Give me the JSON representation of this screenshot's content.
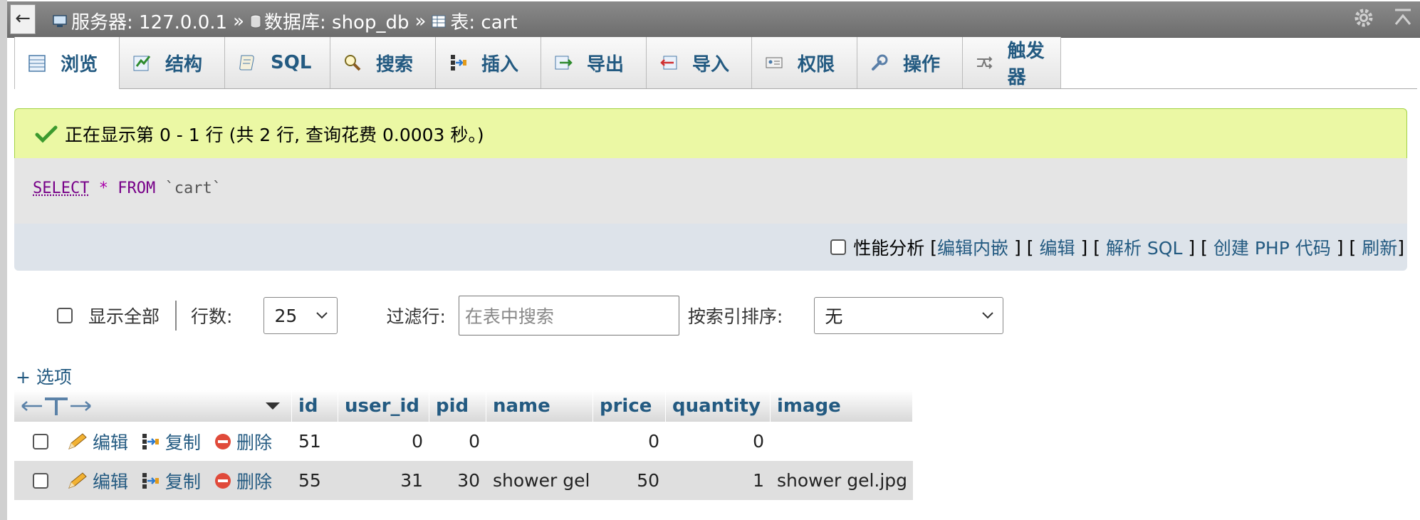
{
  "breadcrumb": {
    "server": "服务器: 127.0.0.1",
    "database": "数据库: shop_db",
    "table": "表: cart",
    "separator": "»"
  },
  "nav_back": "←",
  "tabs": [
    {
      "label": "浏览",
      "icon": "browse-icon"
    },
    {
      "label": "结构",
      "icon": "structure-icon"
    },
    {
      "label": "SQL",
      "icon": "sql-icon"
    },
    {
      "label": "搜索",
      "icon": "search-icon"
    },
    {
      "label": "插入",
      "icon": "insert-icon"
    },
    {
      "label": "导出",
      "icon": "export-icon"
    },
    {
      "label": "导入",
      "icon": "import-icon"
    },
    {
      "label": "权限",
      "icon": "privileges-icon"
    },
    {
      "label": "操作",
      "icon": "wrench-icon"
    },
    {
      "label": "触发器",
      "icon": "triggers-icon"
    }
  ],
  "message": "正在显示第 0 - 1 行 (共 2 行, 查询花费 0.0003 秒。)",
  "sql": {
    "select": "SELECT",
    "star": "*",
    "from": "FROM",
    "table": "`cart`"
  },
  "sql_links": {
    "profiling": "性能分析",
    "open": "[",
    "inline_edit": "编辑内嵌",
    "mid1": "] [",
    "edit": "编辑",
    "mid2": "] [",
    "explain": "解析 SQL",
    "mid3": "] [",
    "php": "创建 PHP 代码",
    "mid4": "] [",
    "refresh": "刷新",
    "close": "]"
  },
  "navigation": {
    "show_all": "显示全部",
    "rows_label": "行数:",
    "rows_value": "25",
    "filter_label": "过滤行:",
    "filter_placeholder": "在表中搜索",
    "sort_label": "按索引排序:",
    "sort_value": "无"
  },
  "options_link": "+ 选项",
  "table": {
    "columns": [
      "id",
      "user_id",
      "pid",
      "name",
      "price",
      "quantity",
      "image"
    ],
    "action_labels": {
      "edit": "编辑",
      "copy": "复制",
      "delete": "删除"
    },
    "rows": [
      {
        "id": "51",
        "user_id": "0",
        "pid": "0",
        "name": "",
        "price": "0",
        "quantity": "0",
        "image": ""
      },
      {
        "id": "55",
        "user_id": "31",
        "pid": "30",
        "name": "shower gel",
        "price": "50",
        "quantity": "1",
        "image": "shower gel.jpg"
      }
    ]
  },
  "colors": {
    "link": "#235a81",
    "success_bg": "#ebf8a4",
    "topbar": "#7a7a7a"
  }
}
